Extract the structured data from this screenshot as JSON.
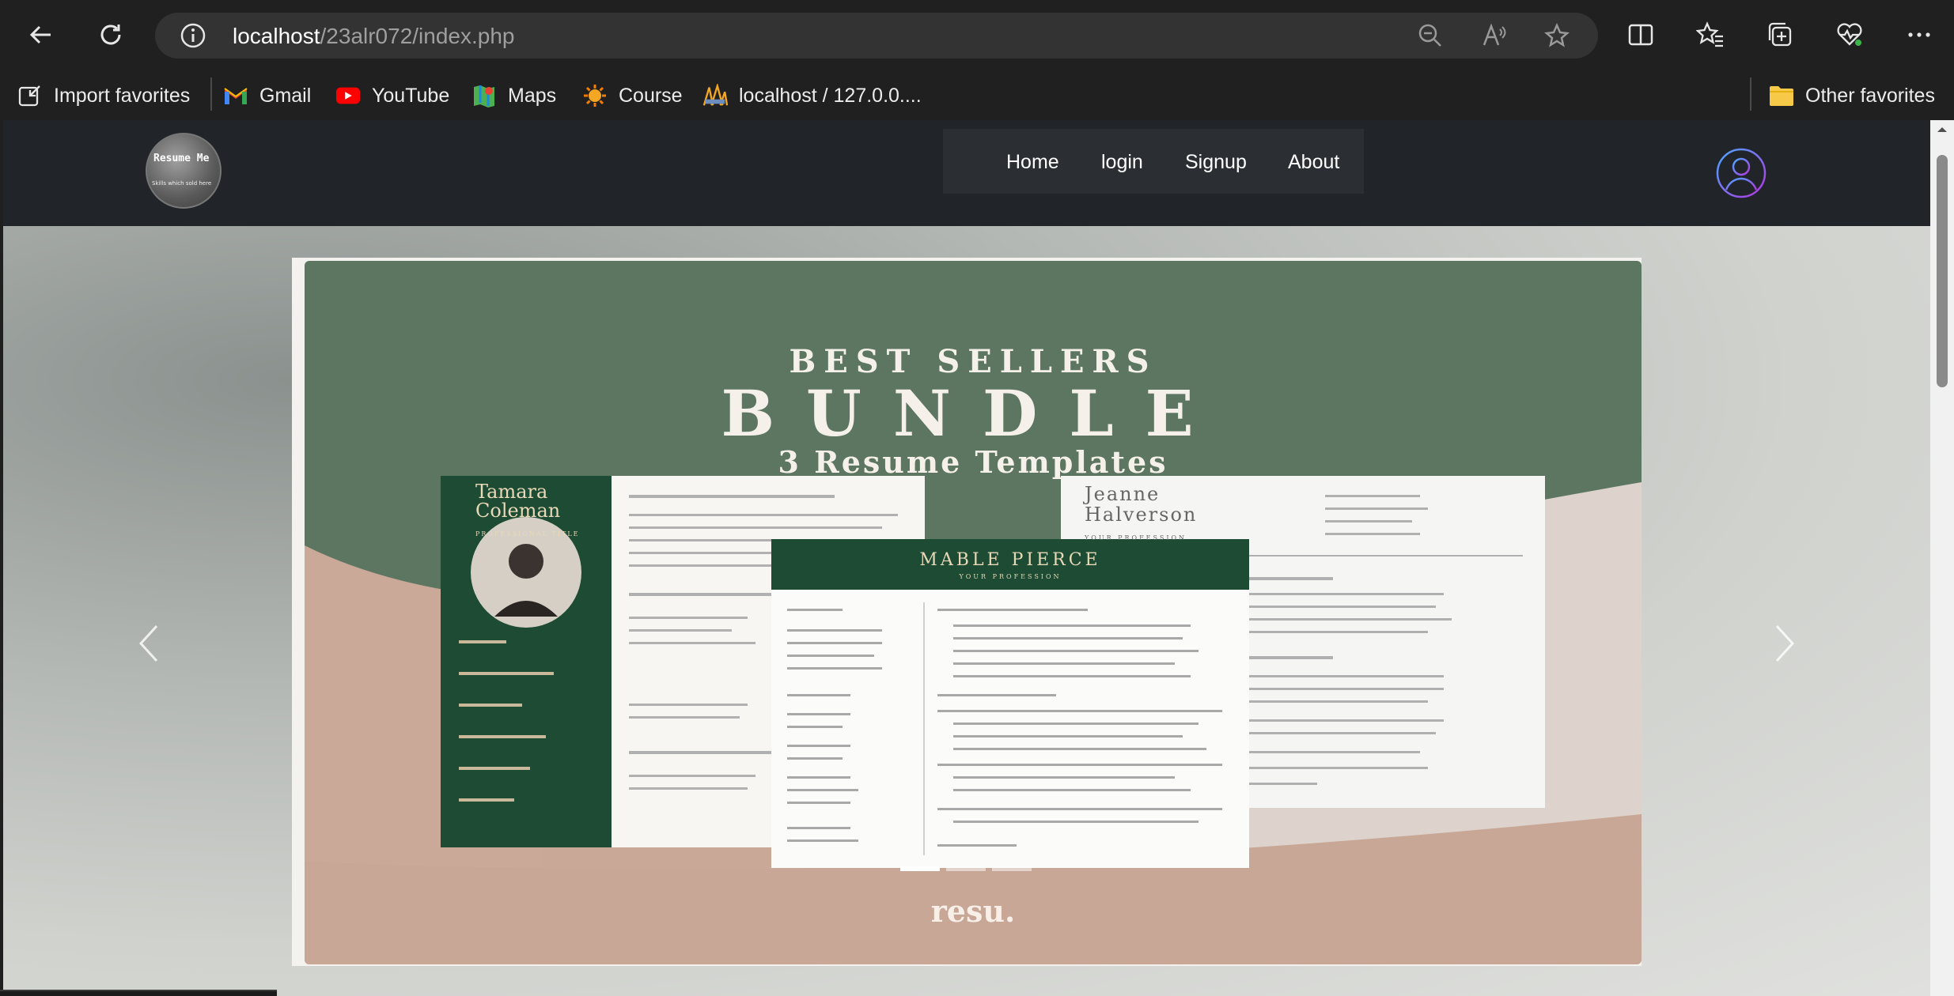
{
  "browser": {
    "url_host": "localhost",
    "url_path": "/23alr072/index.php"
  },
  "favorites": [
    {
      "label": "Import favorites",
      "icon": "import-icon"
    },
    {
      "label": "Gmail",
      "icon": "gmail-icon"
    },
    {
      "label": "YouTube",
      "icon": "youtube-icon"
    },
    {
      "label": "Maps",
      "icon": "maps-icon"
    },
    {
      "label": "Course",
      "icon": "course-icon"
    },
    {
      "label": "localhost / 127.0.0....",
      "icon": "phpmyadmin-icon"
    }
  ],
  "other_favorites": "Other favorites",
  "site": {
    "logo_text": "Resume Me",
    "logo_sub": "Skills which sold here",
    "nav": [
      "Home",
      "login",
      "Signup",
      "About"
    ]
  },
  "slide": {
    "headline_small": "BEST SELLERS",
    "headline_big": "BUNDLE",
    "headline_sub": "3 Resume Templates",
    "resume_left_name_1": "Tamara",
    "resume_left_name_2": "Coleman",
    "resume_left_title": "PROFESSIONAL TITLE",
    "resume_mid_name": "MABLE PIERCE",
    "resume_mid_title": "YOUR PROFESSION",
    "resume_right_name_1": "Jeanne",
    "resume_right_name_2": "Halverson",
    "resume_right_title": "YOUR PROFESSION",
    "brand": "resu."
  },
  "colors": {
    "site_bar": "#212529",
    "slide_green": "#5d7661",
    "resume_green": "#1f4a36"
  }
}
